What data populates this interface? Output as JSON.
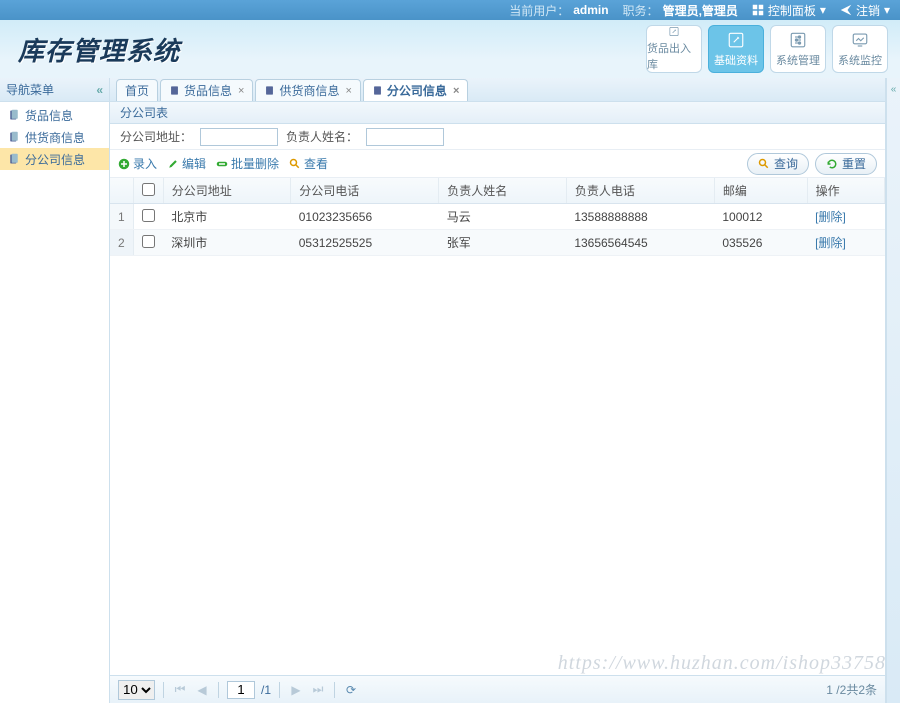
{
  "topbar": {
    "user_label": "当前用户：",
    "user_value": "admin",
    "role_label": "职务：",
    "role_value": "管理员,管理员",
    "ctrl_panel": "控制面板",
    "logout": "注销"
  },
  "header": {
    "title": "库存管理系统",
    "navbtns": [
      {
        "label": "货品出入库",
        "icon": "edit-square"
      },
      {
        "label": "基础资料",
        "icon": "edit-square",
        "active": true
      },
      {
        "label": "系统管理",
        "icon": "settings-square"
      },
      {
        "label": "系统监控",
        "icon": "monitor"
      }
    ]
  },
  "sidebar": {
    "title": "导航菜单",
    "items": [
      {
        "label": "货品信息"
      },
      {
        "label": "供货商信息"
      },
      {
        "label": "分公司信息",
        "selected": true
      }
    ]
  },
  "tabs": [
    {
      "label": "首页",
      "closable": false
    },
    {
      "label": "货品信息",
      "closable": true
    },
    {
      "label": "供货商信息",
      "closable": true
    },
    {
      "label": "分公司信息",
      "closable": true,
      "active": true
    }
  ],
  "panel": {
    "title": "分公司表"
  },
  "search": {
    "addr_label": "分公司地址：",
    "addr_value": "",
    "mgr_label": "负责人姓名：",
    "mgr_value": ""
  },
  "toolbar": {
    "add": "录入",
    "edit": "编辑",
    "batch_del": "批量删除",
    "view": "查看",
    "query": "查询",
    "reset": "重置"
  },
  "table": {
    "columns": [
      "分公司地址",
      "分公司电话",
      "负责人姓名",
      "负责人电话",
      "邮编",
      "操作"
    ],
    "rows": [
      {
        "addr": "北京市",
        "phone": "01023235656",
        "mgr": "马云",
        "mgr_phone": "13588888888",
        "zip": "100012",
        "del": "[删除]"
      },
      {
        "addr": "深圳市",
        "phone": "05312525525",
        "mgr": "张军",
        "mgr_phone": "13656564545",
        "zip": "035526",
        "del": "[删除]"
      }
    ]
  },
  "pagination": {
    "page_size": "10",
    "current": "1",
    "total_pages": "/1",
    "info": "1 /2共2条"
  },
  "watermark": "https://www.huzhan.com/ishop33758"
}
